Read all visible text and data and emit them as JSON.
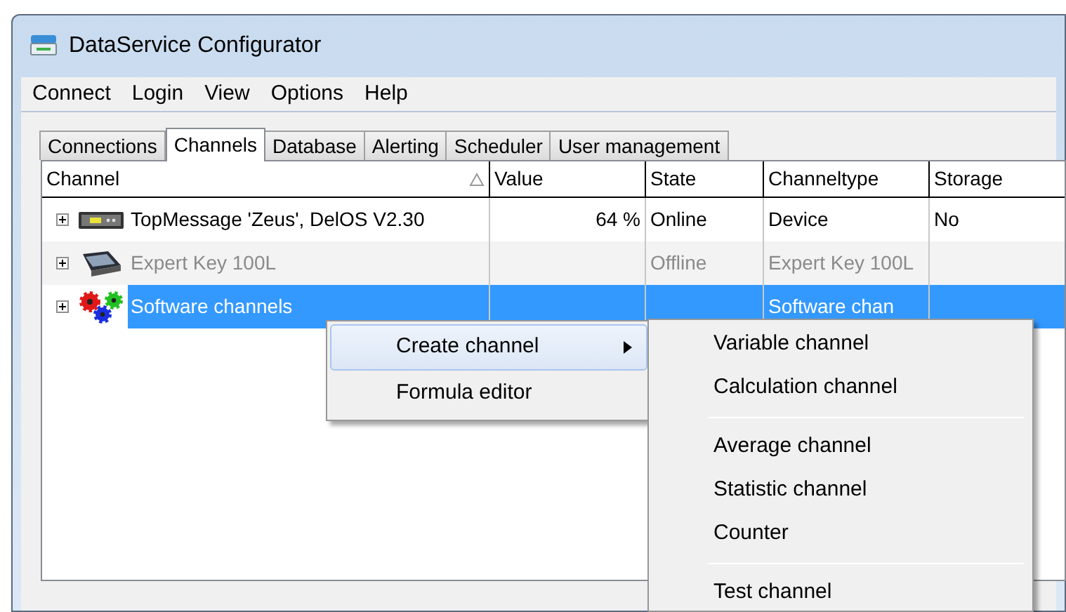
{
  "window": {
    "title": "DataService Configurator"
  },
  "menu": [
    "Connect",
    "Login",
    "View",
    "Options",
    "Help"
  ],
  "tabs": [
    {
      "label": "Connections",
      "selected": false
    },
    {
      "label": "Channels",
      "selected": true
    },
    {
      "label": "Database",
      "selected": false
    },
    {
      "label": "Alerting",
      "selected": false
    },
    {
      "label": "Scheduler",
      "selected": false
    },
    {
      "label": "User management",
      "selected": false
    }
  ],
  "table": {
    "columns": [
      {
        "label": "Channel",
        "sorted": true
      },
      {
        "label": "Value",
        "sorted": false
      },
      {
        "label": "State",
        "sorted": false
      },
      {
        "label": "Channeltype",
        "sorted": false
      },
      {
        "label": "Storage",
        "sorted": false
      }
    ],
    "rows": [
      {
        "kind": "device",
        "expanded": false,
        "selected": false,
        "disabled": false,
        "cells": [
          "TopMessage 'Zeus', DelOS V2.30",
          "64 %",
          "Online",
          "Device",
          "No"
        ]
      },
      {
        "kind": "scanner",
        "expanded": false,
        "selected": false,
        "disabled": true,
        "cells": [
          "Expert Key 100L",
          "",
          "Offline",
          "Expert Key 100L",
          ""
        ]
      },
      {
        "kind": "software",
        "expanded": false,
        "selected": true,
        "disabled": false,
        "cells": [
          "Software channels",
          "",
          "",
          "Software chan",
          ""
        ]
      }
    ]
  },
  "context_menu": {
    "items": [
      {
        "label": "Create channel",
        "submenu": true,
        "selected": true
      },
      {
        "label": "Formula editor",
        "submenu": false,
        "selected": false
      }
    ]
  },
  "submenu": {
    "groups": [
      [
        "Variable channel",
        "Calculation channel"
      ],
      [
        "Average channel",
        "Statistic channel",
        "Counter"
      ],
      [
        "Test channel"
      ]
    ]
  }
}
